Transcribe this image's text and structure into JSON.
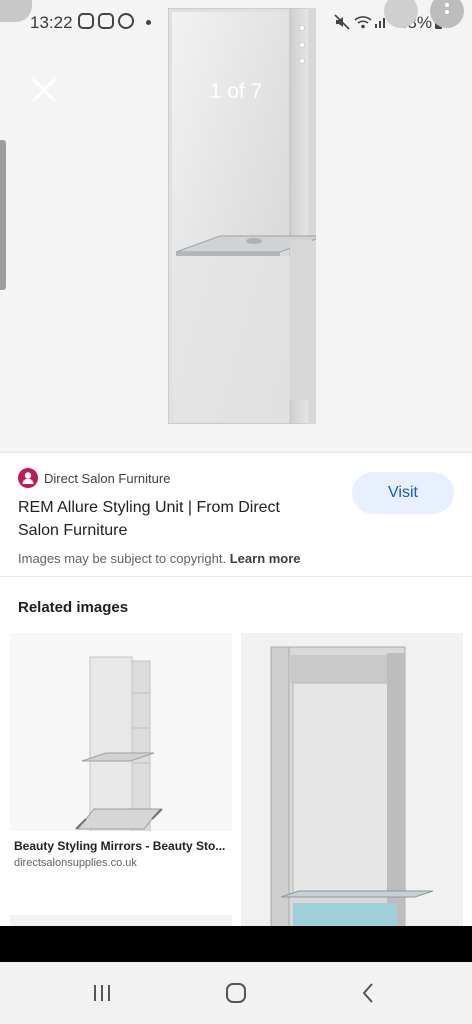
{
  "status_bar": {
    "time": "13:22",
    "battery": "48%",
    "icons": [
      "instagram-icon",
      "instagram-icon",
      "whatsapp-icon",
      "notification-dot-icon",
      "mute-icon",
      "wifi-icon",
      "signal-icon",
      "battery-icon"
    ]
  },
  "viewer": {
    "counter": "1 of 7",
    "close_icon": "close-icon",
    "menu_icons": [
      "lens-icon",
      "more-vertical-icon"
    ]
  },
  "result": {
    "source_name": "Direct Salon Furniture",
    "title": "REM Allure Styling Unit | From Direct Salon Furniture",
    "visit_label": "Visit",
    "copyright_text": "Images may be subject to copyright.",
    "learn_more": "Learn more"
  },
  "related": {
    "heading": "Related images",
    "items": [
      {
        "caption": "Beauty Styling Mirrors - Beauty Sto...",
        "domain": "directsalonsupplies.co.uk"
      }
    ]
  },
  "nav": {
    "recents_icon": "recents-icon",
    "home_icon": "home-icon",
    "back_icon": "back-icon"
  },
  "colors": {
    "visit_bg": "#e8f0fe",
    "visit_text": "#1a57c9",
    "favicon": "#c2185b"
  }
}
